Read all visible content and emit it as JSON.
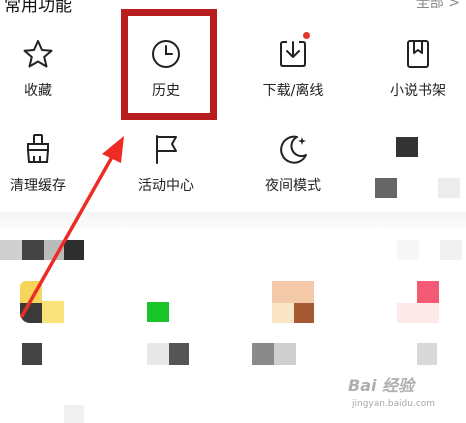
{
  "section": {
    "title": "常用功能",
    "more": "全部 >"
  },
  "tiles": [
    {
      "label": "收藏",
      "icon": "star-icon"
    },
    {
      "label": "历史",
      "icon": "clock-icon"
    },
    {
      "label": "下载/离线",
      "icon": "download-icon"
    },
    {
      "label": "小说书架",
      "icon": "bookmark-book-icon"
    },
    {
      "label": "清理缓存",
      "icon": "broom-icon"
    },
    {
      "label": "活动中心",
      "icon": "flag-icon"
    },
    {
      "label": "夜间模式",
      "icon": "moon-icon"
    }
  ],
  "colors": {
    "highlight": "#b81e1e",
    "arrow": "#ee2b24",
    "badge": "#e5342c"
  },
  "watermark": {
    "brand": "Bai 经验",
    "url": "jingyan.baidu.com"
  }
}
